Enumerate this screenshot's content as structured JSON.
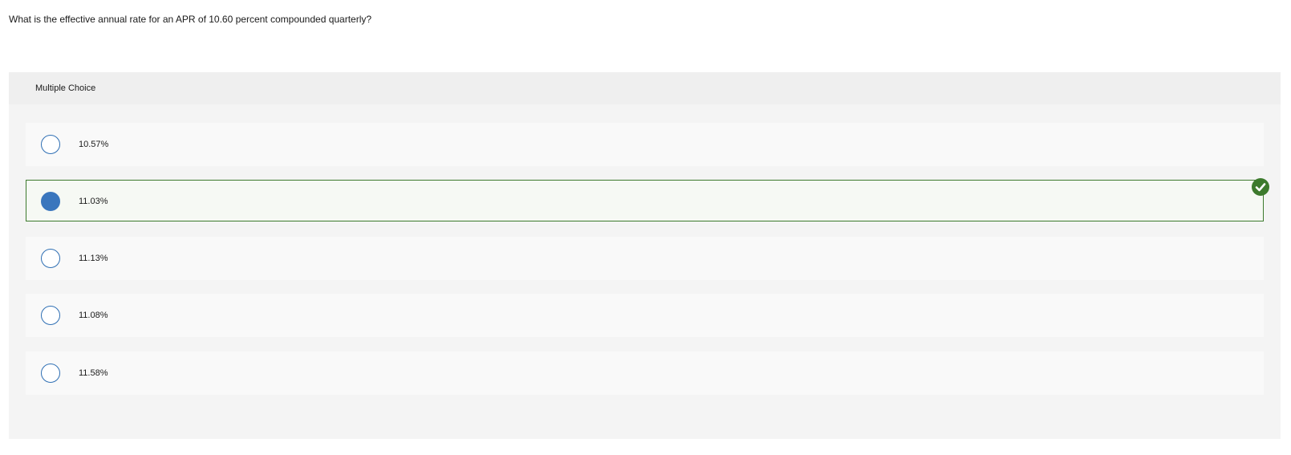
{
  "question": {
    "text": "What is the effective annual rate for an APR of 10.60 percent compounded quarterly?"
  },
  "multiple_choice": {
    "header_label": "Multiple Choice",
    "options": [
      {
        "label": "10.57%",
        "selected": false,
        "correct": false
      },
      {
        "label": "11.03%",
        "selected": true,
        "correct": true
      },
      {
        "label": "11.13%",
        "selected": false,
        "correct": false
      },
      {
        "label": "11.08%",
        "selected": false,
        "correct": false
      },
      {
        "label": "11.58%",
        "selected": false,
        "correct": false
      }
    ]
  },
  "icons": {
    "radio_unselected": "radio-empty-icon",
    "radio_selected": "radio-filled-icon",
    "correct_indicator": "checkmark-circle-icon"
  },
  "colors": {
    "radio_border": "#2f6fb4",
    "radio_selected_fill": "#3a76bd",
    "correct_green": "#3d7a2d",
    "panel_background": "#f4f4f4",
    "option_background": "#f9f9f9"
  }
}
